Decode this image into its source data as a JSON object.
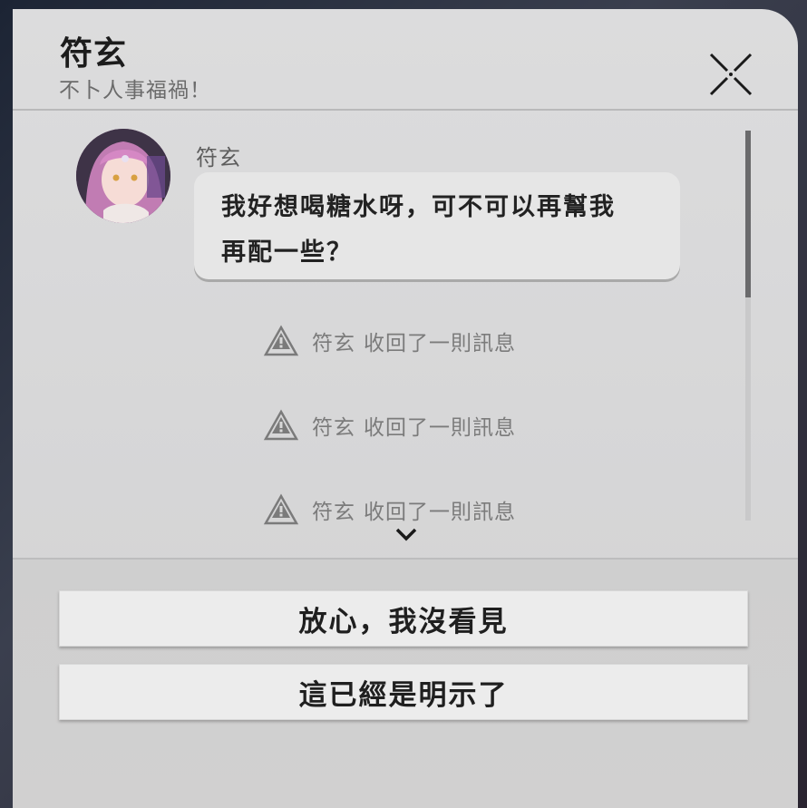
{
  "header": {
    "title": "符玄",
    "subtitle": "不卜人事福禍！"
  },
  "messages": [
    {
      "type": "text",
      "sender": "符玄",
      "lines": [
        "我好想喝糖水呀，可不可以再幫我",
        "再配一些？"
      ]
    }
  ],
  "system_notices": [
    {
      "sender": "符玄",
      "text": "收回了一則訊息"
    },
    {
      "sender": "符玄",
      "text": "收回了一則訊息"
    },
    {
      "sender": "符玄",
      "text": "收回了一則訊息"
    }
  ],
  "choices": [
    {
      "label": "放心，我沒看見"
    },
    {
      "label": "這已經是明示了"
    }
  ],
  "icons": {
    "close": "close-icon",
    "notice": "warning-icon",
    "more": "chevron-down-icon"
  },
  "colors": {
    "panel_bg": "#dcdcdd",
    "bubble_bg": "#e6e6e6",
    "choice_bg": "#ececec",
    "text_primary": "#1c1c1c",
    "text_muted": "#7b7b7b"
  }
}
